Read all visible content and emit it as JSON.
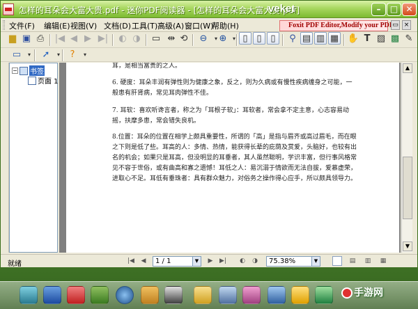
{
  "window": {
    "title": "怎样的耳朵会大富大贵.pdf - 迷你PDF阅读器 - [怎样的耳朵会大富大贵.pdf]",
    "brand": "veket"
  },
  "menu": [
    {
      "label": "文件(F)",
      "name": "menu-file"
    },
    {
      "label": "编辑(E)",
      "name": "menu-edit"
    },
    {
      "label": "视图(V)",
      "name": "menu-view"
    },
    {
      "label": "文档(D)",
      "name": "menu-document"
    },
    {
      "label": "工具(T)",
      "name": "menu-tools"
    },
    {
      "label": "高级(A)",
      "name": "menu-advanced"
    },
    {
      "label": "窗口(W)",
      "name": "menu-window"
    },
    {
      "label": "帮助(H)",
      "name": "menu-help"
    }
  ],
  "ad": {
    "text": "Foxit PDF Editor,Modify your PDF!"
  },
  "sidebar": {
    "root_label": "书签",
    "child_label": "页面 1"
  },
  "document": {
    "paragraphs": [
      "耳，是相当富贵的之人。",
      "6. 硬度：耳朵丰润有弹性则为健康之象，反之，则为久病或有慢性疾病缠身之可能，一般患有肝肾病，常见耳肉弹性不佳。",
      "7. 耳软：喜欢听谗言者，称之为「耳根子软」：耳软者，常会拿不定主意，心志容易动摇，扶摩多患，常会错失良机。",
      "8.位置：耳朵的位置在相学上颇具重要性，所谓的「高」是指与眉齐或高过眉毛，而在眼之下则是低了些。耳高的人：多情、热情，能获得长辈的庇荫及赏爱，头脑好，也较有出名的机会；如果只是耳高，但没明显的耳垂者，其人虽然聪明，学识丰富，但行事风格常见不容于世俗，或有曲高和寡之遗憾！耳低之人：易沉溺于情欲而无法自拔，爱慕虚荣，进取心不足。耳低有垂珠者：具有群众魅力，对俗务之操作得心应手，所以颇具领导力。"
    ]
  },
  "status": {
    "ready": "就绪",
    "page_field": "1 / 1",
    "zoom_field": "75.38%"
  },
  "watermark": {
    "text": "手游网"
  },
  "colors": {
    "title_green": "#7cbb31",
    "sidebar_selection": "#316ac5",
    "doc_background": "#808080"
  }
}
